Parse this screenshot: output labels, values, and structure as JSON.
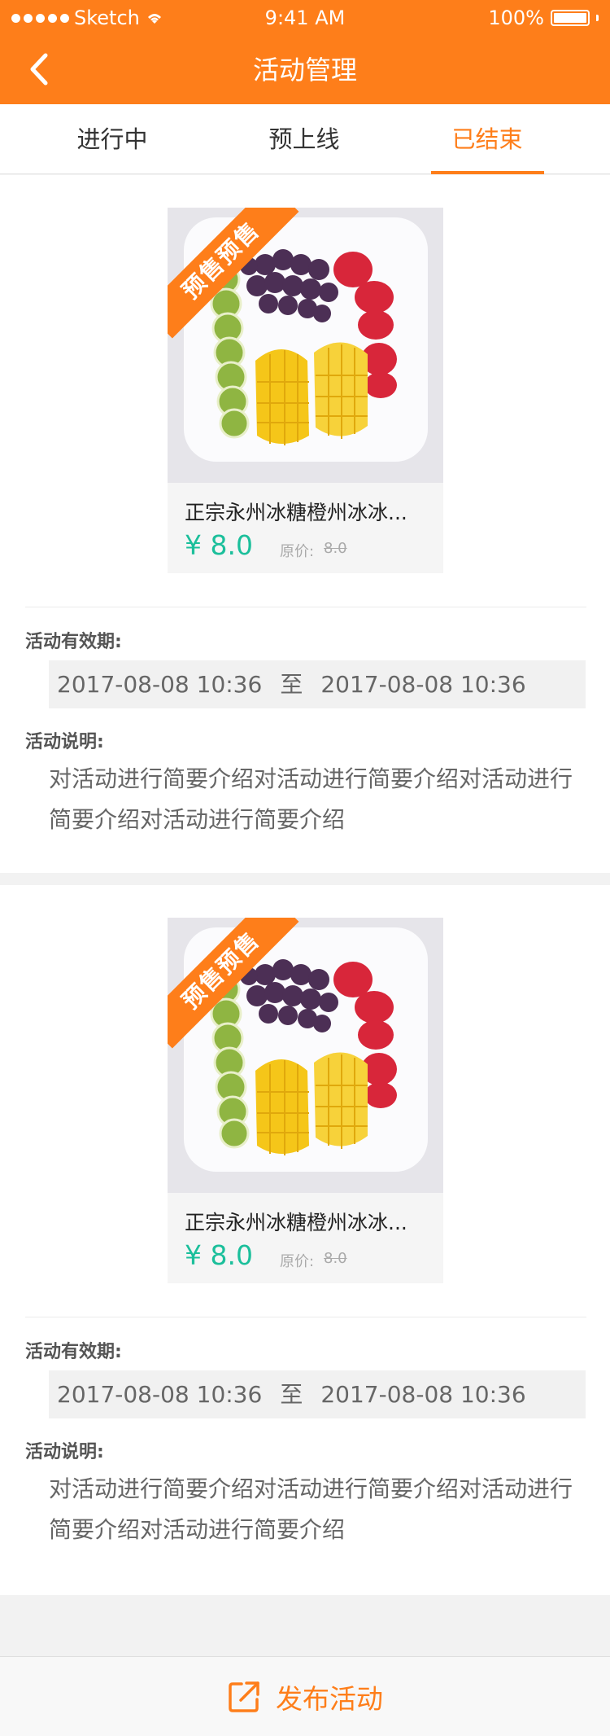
{
  "status_bar": {
    "carrier": "Sketch",
    "time": "9:41 AM",
    "battery": "100%"
  },
  "nav": {
    "title": "活动管理"
  },
  "tabs": [
    {
      "label": "进行中"
    },
    {
      "label": "预上线"
    },
    {
      "label": "已结束",
      "active": true
    }
  ],
  "activities": [
    {
      "badge": "预售预售",
      "product_name": "正宗永州冰糖橙州冰冰...",
      "price": "¥ 8.0",
      "original_price_label": "原价:",
      "original_price": "8.0",
      "validity_label": "活动有效期:",
      "start": "2017-08-08  10:36",
      "separator": "至",
      "end": "2017-08-08  10:36",
      "description_label": "活动说明:",
      "description": "对活动进行简要介绍对活动进行简要介绍对活动进行简要介绍对活动进行简要介绍"
    },
    {
      "badge": "预售预售",
      "product_name": "正宗永州冰糖橙州冰冰...",
      "price": "¥ 8.0",
      "original_price_label": "原价:",
      "original_price": "8.0",
      "validity_label": "活动有效期:",
      "start": "2017-08-08  10:36",
      "separator": "至",
      "end": "2017-08-08  10:36",
      "description_label": "活动说明:",
      "description": "对活动进行简要介绍对活动进行简要介绍对活动进行简要介绍对活动进行简要介绍"
    }
  ],
  "footer": {
    "publish_label": "发布活动"
  },
  "colors": {
    "accent": "#fe7e1a",
    "price": "#1bbf9b"
  }
}
